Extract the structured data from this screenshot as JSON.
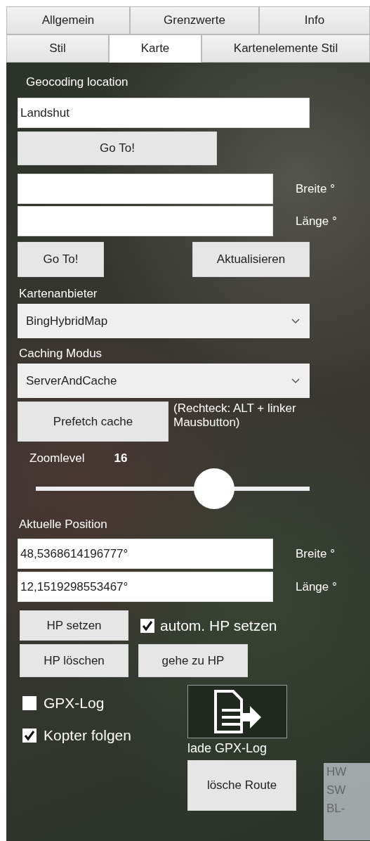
{
  "tab_rows": [
    {
      "tabs": [
        {
          "label": "Allgemein",
          "selected": false
        },
        {
          "label": "Grenzwerte",
          "selected": false
        },
        {
          "label": "Info",
          "selected": false
        }
      ]
    },
    {
      "tabs": [
        {
          "label": "Stil",
          "selected": false
        },
        {
          "label": "Karte",
          "selected": true
        },
        {
          "label": "Kartenelemente Stil",
          "selected": false
        }
      ]
    }
  ],
  "geocoding": {
    "label": "Geocoding location",
    "value": "Landshut",
    "button": "Go To!"
  },
  "coordinates": {
    "fields": [
      {
        "label": "Breite °"
      },
      {
        "label": "Länge °"
      }
    ],
    "goto_button": "Go To!",
    "refresh_button": "Aktualisieren"
  },
  "map_provider": {
    "label": "Kartenanbieter",
    "value": "BingHybridMap"
  },
  "caching_mode": {
    "label": "Caching Modus",
    "value": "ServerAndCache"
  },
  "prefetch": {
    "button": "Prefetch cache",
    "note": "(Rechteck: ALT + linker Mausbutton)"
  },
  "zoom": {
    "label": "Zoomlevel",
    "value": "16",
    "level": 0.65
  },
  "current_position": {
    "label": "Aktuelle Position",
    "fields": [
      {
        "value": "48,5368614196777°",
        "label": "Breite °"
      },
      {
        "value": "12,1519298553467°",
        "label": "Länge °"
      }
    ]
  },
  "home_point": {
    "set_button": "HP setzen",
    "auto": {
      "label": "autom. HP setzen",
      "checked": true
    },
    "delete_button": "HP löschen",
    "goto_button": "gehe zu HP"
  },
  "options": [
    {
      "label": "GPX-Log",
      "checked": false
    },
    {
      "label": "Kopter folgen",
      "checked": true
    }
  ],
  "load_gpx": {
    "label": "lade GPX-Log"
  },
  "clear_route_button": "lösche Route",
  "overlay_panel": {
    "lines": [
      "HW",
      "SW",
      "BL-"
    ]
  }
}
